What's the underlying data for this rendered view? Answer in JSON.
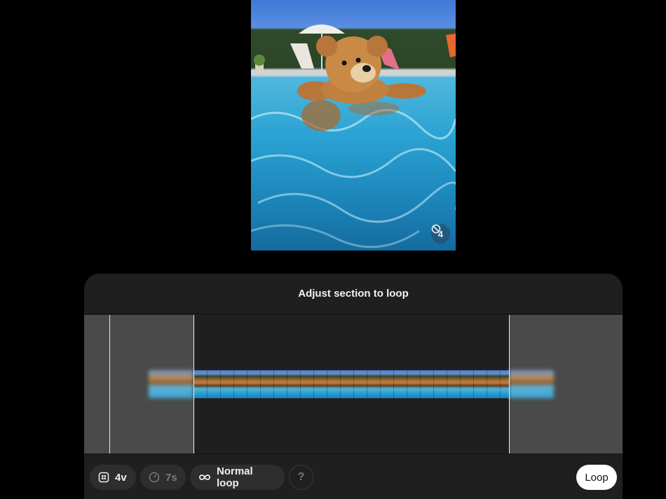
{
  "preview": {
    "badge_count": "4",
    "badge_icon": "spiral-icon"
  },
  "panel": {
    "title": "Adjust section to loop"
  },
  "toolbar": {
    "variants_label": "4v",
    "variants_icon": "grid-icon",
    "duration_label": "7s",
    "duration_icon": "clock-icon",
    "loop_mode_label": "Normal loop",
    "loop_mode_icon": "infinity-icon",
    "help_label": "?",
    "loop_button_label": "Loop"
  },
  "colors": {
    "background": "#000000",
    "panel": "#1f1f1f",
    "dimmed_region": "#4a4a4a",
    "primary_button": "#ffffff"
  }
}
